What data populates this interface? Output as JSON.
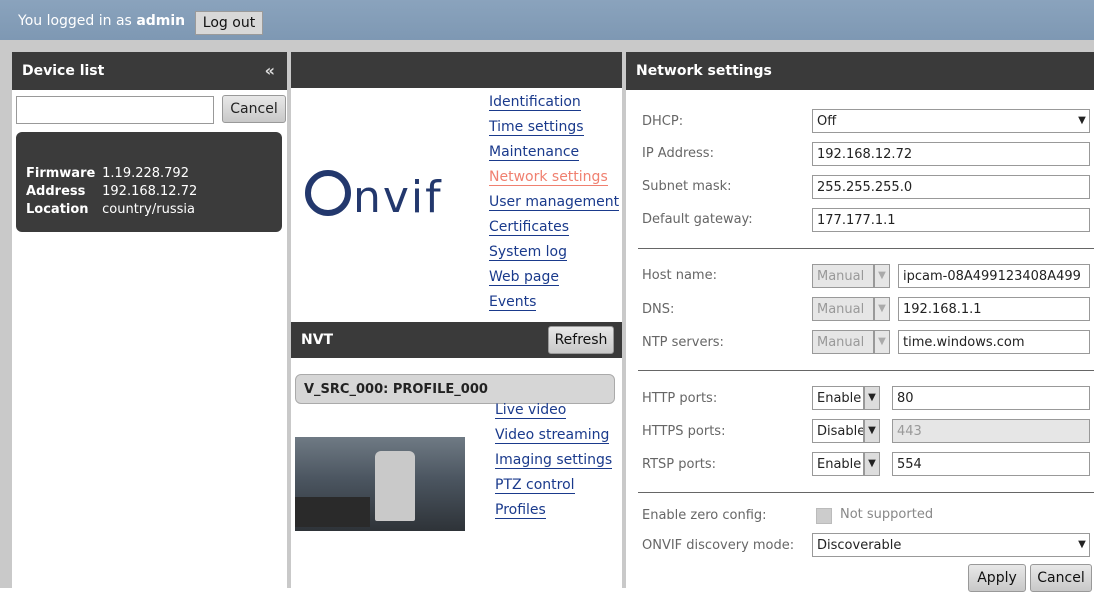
{
  "topbar": {
    "logged_in_text": "You logged in as",
    "user": "admin",
    "logout_label": "Log out"
  },
  "device_list": {
    "title": "Device list",
    "collapse_glyph": "«",
    "search_value": "",
    "cancel_label": "Cancel",
    "device": {
      "firmware_key": "Firmware",
      "firmware_val": "1.19.228.792",
      "address_key": "Address",
      "address_val": "192.168.12.72",
      "location_key": "Location",
      "location_val": "country/russia"
    }
  },
  "device_menu": {
    "logo": "nvif",
    "links": [
      "Identification",
      "Time settings",
      "Maintenance",
      "Network settings",
      "User management",
      "Certificates",
      "System log",
      "Web page",
      "Events"
    ],
    "active_index": 3
  },
  "nvt": {
    "title": "NVT",
    "refresh_label": "Refresh",
    "profile_label": "V_SRC_000: PROFILE_000",
    "links": [
      "Live video",
      "Video streaming",
      "Imaging settings",
      "PTZ control",
      "Profiles"
    ]
  },
  "network": {
    "title": "Network settings",
    "dhcp_label": "DHCP:",
    "dhcp_value": "Off",
    "ip_label": "IP Address:",
    "ip_value": "192.168.12.72",
    "mask_label": "Subnet mask:",
    "mask_value": "255.255.255.0",
    "gateway_label": "Default gateway:",
    "gateway_value": "177.177.1.1",
    "host_label": "Host name:",
    "host_mode": "Manual",
    "host_value": "ipcam-08A499123408A499",
    "dns_label": "DNS:",
    "dns_mode": "Manual",
    "dns_value": "192.168.1.1",
    "ntp_label": "NTP servers:",
    "ntp_mode": "Manual",
    "ntp_value": "time.windows.com",
    "http_label": "HTTP ports:",
    "http_mode": "Enable",
    "http_value": "80",
    "https_label": "HTTPS ports:",
    "https_mode": "Disable",
    "https_value": "443",
    "rtsp_label": "RTSP ports:",
    "rtsp_mode": "Enable",
    "rtsp_value": "554",
    "zero_label": "Enable zero config:",
    "zero_value": "Not supported",
    "discovery_label": "ONVIF discovery mode:",
    "discovery_value": "Discoverable",
    "apply_label": "Apply",
    "cancel_label": "Cancel"
  }
}
